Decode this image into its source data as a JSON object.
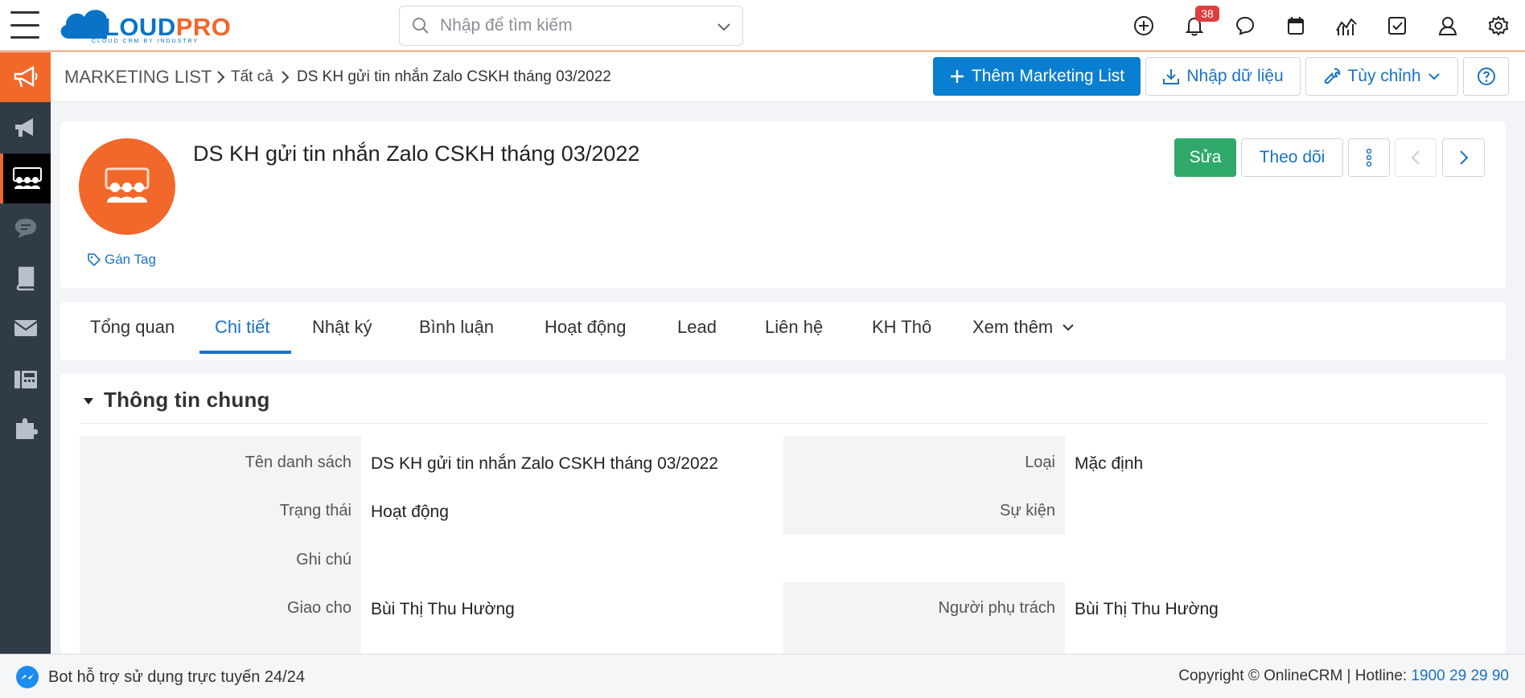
{
  "brand": {
    "logo_left": "CLOUD",
    "logo_right": "PRO",
    "logo_sub": "CLOUD CRM BY INDUSTRY"
  },
  "search": {
    "placeholder": "Nhập để tìm kiếm"
  },
  "notifications": {
    "count": "38"
  },
  "breadcrumb": {
    "module": "MARKETING LIST",
    "all": "Tất cả",
    "current": "DS KH gửi tin nhắn Zalo CSKH tháng 03/2022"
  },
  "actions": {
    "add_label": "Thêm Marketing List",
    "import_label": "Nhập dữ liệu",
    "customize_label": "Tùy chỉnh"
  },
  "record": {
    "title": "DS KH gửi tin nhắn Zalo CSKH tháng 03/2022",
    "tag_label": "Gán Tag",
    "edit_label": "Sửa",
    "follow_label": "Theo dõi"
  },
  "tabs": [
    {
      "label": "Tổng quan"
    },
    {
      "label": "Chi tiết"
    },
    {
      "label": "Nhật ký"
    },
    {
      "label": "Bình luận"
    },
    {
      "label": "Hoạt động"
    },
    {
      "label": "Lead"
    },
    {
      "label": "Liên hệ"
    },
    {
      "label": "KH Thô"
    },
    {
      "label": "Xem thêm"
    }
  ],
  "details": {
    "section_title": "Thông tin chung",
    "fields": {
      "list_name": {
        "label": "Tên danh sách",
        "value": "DS KH gửi tin nhắn Zalo CSKH tháng 03/2022"
      },
      "type": {
        "label": "Loại",
        "value": "Mặc định"
      },
      "status": {
        "label": "Trạng thái",
        "value": "Hoạt động"
      },
      "event": {
        "label": "Sự kiện",
        "value": ""
      },
      "note": {
        "label": "Ghi chú",
        "value": ""
      },
      "assigned_to": {
        "label": "Giao cho",
        "value": "Bùi Thị Thu Hường"
      },
      "owner": {
        "label": "Người phụ trách",
        "value": "Bùi Thị Thu Hường"
      }
    }
  },
  "footer": {
    "bot_text": "Bot hỗ trợ sử dụng trực tuyến 24/24",
    "copyright": "Copyright © OnlineCRM | Hotline: ",
    "hotline": "1900 29 29 90"
  },
  "colors": {
    "accent": "#f2672a",
    "primary": "#0a7fd1",
    "success": "#2ea96a",
    "sidebar": "#313b47"
  },
  "icons": [
    "menu-icon",
    "search-icon",
    "chevron-down-icon",
    "plus-circle-icon",
    "bell-icon",
    "chat-icon",
    "calendar-icon",
    "chart-icon",
    "checkbox-icon",
    "user-icon",
    "gear-icon",
    "megaphone-icon",
    "group-icon",
    "comment-icon",
    "book-icon",
    "mail-icon",
    "fax-icon",
    "puzzle-icon",
    "tag-icon",
    "download-icon",
    "wrench-icon",
    "help-icon",
    "more-vertical-icon",
    "chevron-left-icon",
    "chevron-right-icon",
    "caret-down-icon",
    "messenger-icon"
  ]
}
